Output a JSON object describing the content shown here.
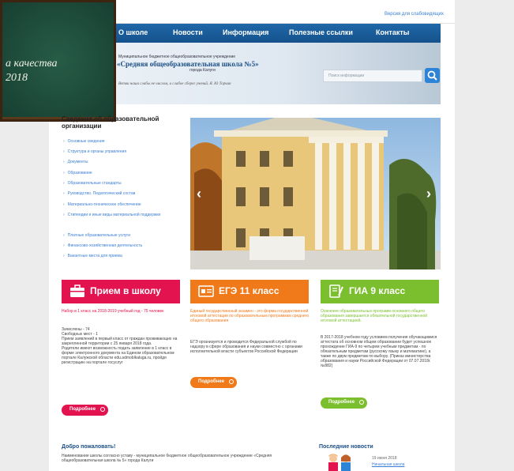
{
  "topbar": {
    "vision_link": "Версия для слабовидящих"
  },
  "nav": {
    "items": [
      "О школе",
      "Новости",
      "Информация",
      "Полезные ссылки",
      "Контакты"
    ]
  },
  "header": {
    "org_line": "Муниципальное бюджетное общеобразовательное учреждение",
    "school_name": "«Средняя общеобразовательная школа №5»",
    "city": "города Калуги",
    "motto": "Ветви наша слабы не числом, а слабое сберег учений.   Я. Ю Торчин",
    "search_placeholder": "Поиск информации"
  },
  "chalkboard": {
    "line1": "а качества",
    "line2": "2018"
  },
  "sidebar": {
    "title": "Сведения об образовательной организации",
    "items": [
      "Основные сведения",
      "Структура и органы управления",
      "Документы",
      "Образование",
      "Образовательные стандарты",
      "Руководство. Педагогический состав",
      "Материально-техническое обеспечение",
      "Стипендии и иные виды материальной поддержки",
      "Платные образовательные услуги",
      "Финансово-хозяйственная деятельность",
      "Вакантные места для приема"
    ]
  },
  "cards": [
    {
      "title": "Прием в школу",
      "color": "#e2134f",
      "lead": "Набор в 1 класс на 2018-2019 учебный год - 75 человек",
      "text": "Зачислены - 74\nСвободных мест - 1\nПрием заявлений в первый класс от граждан проживающих на закрепленной территории с 25 января 2018 года.\nРодители имеют возможность подать заявление в 1 класс в форме электронного документа на Едином образовательном портале Калужской области edu.admoblkaluga.ru, пройдя регистрацию на портале госуслуг",
      "button": "Подробнее"
    },
    {
      "title": "ЕГЭ 11 класс",
      "color": "#f07a1a",
      "lead": "Единый государственный экзамен - это форма государственной итоговой аттестации по образовательным программам среднего общего образования",
      "text": "ЕГЭ организуется и проводится Федеральной службой по надзору в сфере образования и науки совместно с органами исполнительной власти субъектов Российской Федерации",
      "button": "Подробнее"
    },
    {
      "title": "ГИА 9 класс",
      "color": "#7cbf2e",
      "lead": "Освоение образовательных программ основного общего образования завершается обязательной государственной итоговой аттестацией.",
      "text": "В 2017-2018 учебном году условием получения обучающимися аттестата об основном общем образовании будет успешное прохождение ГИА-9 по четырем учебным предметам - по обязательным предметам (русскому языку и математике), а также по двум предметам по выбору. (Приказ министерства образования и науки Российской Федерации от 07.07.2018г. №882)",
      "button": "Подробнее"
    }
  ],
  "welcome": {
    "title": "Добро пожаловать!",
    "text": "Наименование школы согласно уставу - муниципальное бюджетное общеобразовательное учреждение «Средняя общеобразовательная школа № 5» города Калуги"
  },
  "news": {
    "title": "Последние новости",
    "date": "19 июня 2018",
    "link": "Начальная школа"
  },
  "colors": {
    "nav": "#1f67a8",
    "link": "#3a7ed3",
    "search": "#2d83d6"
  }
}
